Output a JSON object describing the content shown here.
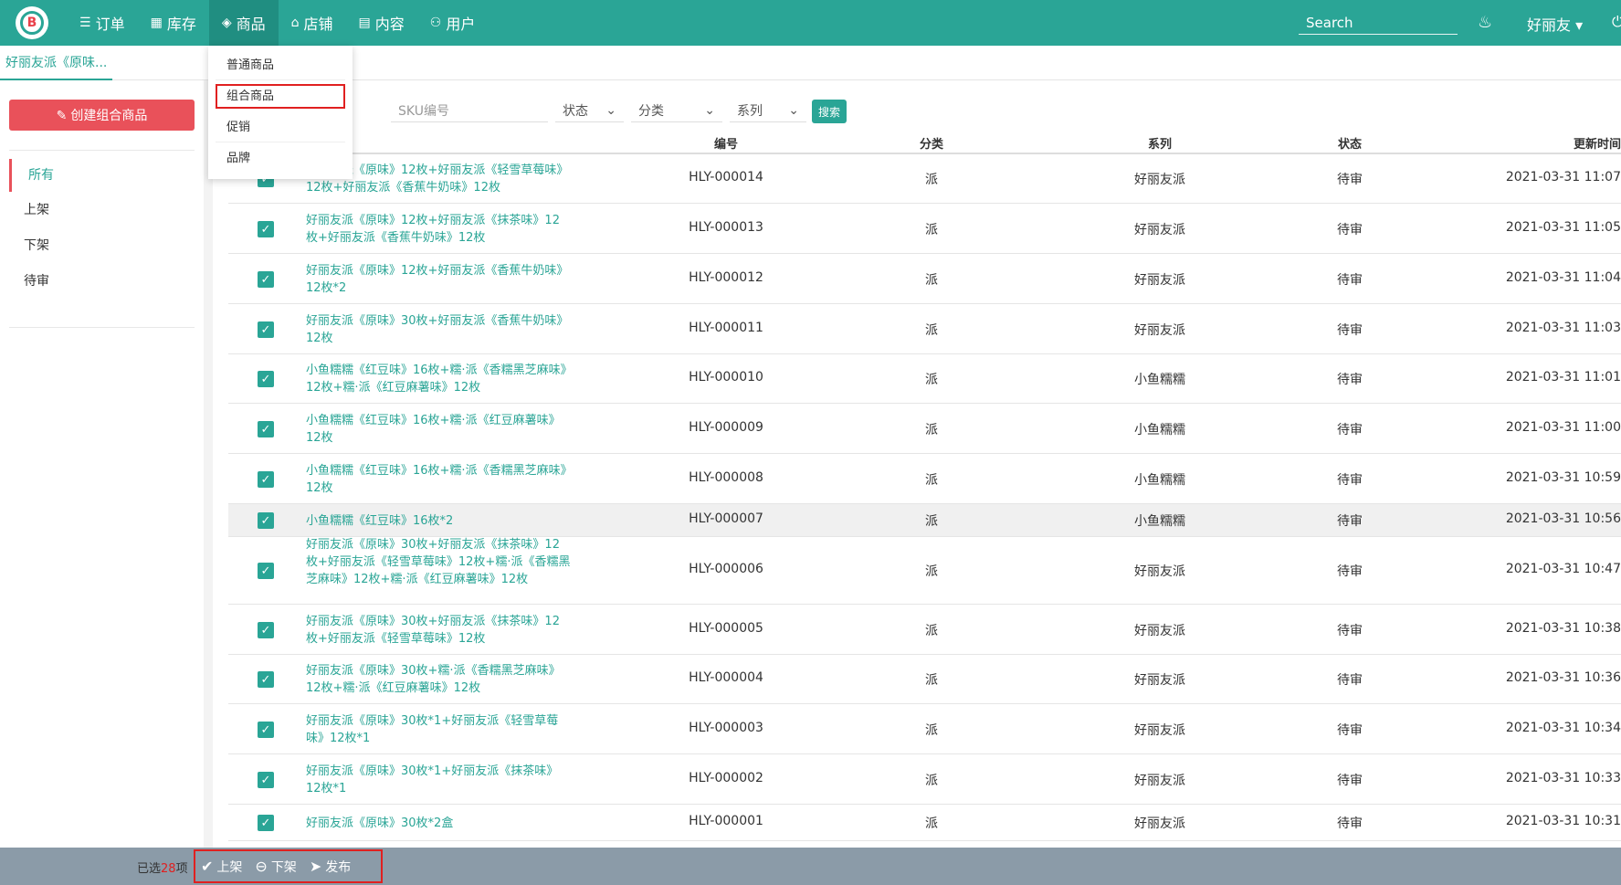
{
  "nav": {
    "items": [
      {
        "label": "订单",
        "icon": "☰"
      },
      {
        "label": "库存",
        "icon": "▦"
      },
      {
        "label": "商品",
        "icon": "◈"
      },
      {
        "label": "店铺",
        "icon": "⌂"
      },
      {
        "label": "内容",
        "icon": "▤"
      },
      {
        "label": "用户",
        "icon": "⚇"
      }
    ],
    "search_placeholder": "Search",
    "user": "好丽友 ▾",
    "bell_icon": "♨",
    "power_icon": "⏻"
  },
  "tab": {
    "label": "好丽友派《原味..."
  },
  "sidebar": {
    "create_button": "创建组合商品",
    "items": [
      "所有",
      "上架",
      "下架",
      "待审"
    ]
  },
  "dropdown": {
    "items": [
      "普通商品",
      "组合商品",
      "促销",
      "品牌"
    ]
  },
  "filters": {
    "sku_placeholder": "SKU编号",
    "status": "状态",
    "category": "分类",
    "series": "系列",
    "search_button": "搜索"
  },
  "table": {
    "headers": {
      "code": "编号",
      "category": "分类",
      "series": "系列",
      "status": "状态",
      "updated": "更新时间"
    },
    "rows": [
      {
        "name": "好丽友派《原味》12枚+好丽友派《轻雪草莓味》12枚+好丽友派《香蕉牛奶味》12枚",
        "code": "HLY-000014",
        "category": "派",
        "series": "好丽友派",
        "status": "待审",
        "updated": "2021-03-31 11:07"
      },
      {
        "name": "好丽友派《原味》12枚+好丽友派《抹茶味》12枚+好丽友派《香蕉牛奶味》12枚",
        "code": "HLY-000013",
        "category": "派",
        "series": "好丽友派",
        "status": "待审",
        "updated": "2021-03-31 11:05"
      },
      {
        "name": "好丽友派《原味》12枚+好丽友派《香蕉牛奶味》12枚*2",
        "code": "HLY-000012",
        "category": "派",
        "series": "好丽友派",
        "status": "待审",
        "updated": "2021-03-31 11:04"
      },
      {
        "name": "好丽友派《原味》30枚+好丽友派《香蕉牛奶味》12枚",
        "code": "HLY-000011",
        "category": "派",
        "series": "好丽友派",
        "status": "待审",
        "updated": "2021-03-31 11:03"
      },
      {
        "name": "小鱼糯糯《红豆味》16枚+糯·派《香糯黑芝麻味》12枚+糯·派《红豆麻薯味》12枚",
        "code": "HLY-000010",
        "category": "派",
        "series": "小鱼糯糯",
        "status": "待审",
        "updated": "2021-03-31 11:01"
      },
      {
        "name": "小鱼糯糯《红豆味》16枚+糯·派《红豆麻薯味》12枚",
        "code": "HLY-000009",
        "category": "派",
        "series": "小鱼糯糯",
        "status": "待审",
        "updated": "2021-03-31 11:00"
      },
      {
        "name": "小鱼糯糯《红豆味》16枚+糯·派《香糯黑芝麻味》12枚",
        "code": "HLY-000008",
        "category": "派",
        "series": "小鱼糯糯",
        "status": "待审",
        "updated": "2021-03-31 10:59"
      },
      {
        "name": "小鱼糯糯《红豆味》16枚*2",
        "code": "HLY-000007",
        "category": "派",
        "series": "小鱼糯糯",
        "status": "待审",
        "updated": "2021-03-31 10:56"
      },
      {
        "name": "好丽友派《原味》30枚+好丽友派《抹茶味》12枚+好丽友派《轻雪草莓味》12枚+糯·派《香糯黑芝麻味》12枚+糯·派《红豆麻薯味》12枚",
        "code": "HLY-000006",
        "category": "派",
        "series": "好丽友派",
        "status": "待审",
        "updated": "2021-03-31 10:47"
      },
      {
        "name": "好丽友派《原味》30枚+好丽友派《抹茶味》12枚+好丽友派《轻雪草莓味》12枚",
        "code": "HLY-000005",
        "category": "派",
        "series": "好丽友派",
        "status": "待审",
        "updated": "2021-03-31 10:38"
      },
      {
        "name": "好丽友派《原味》30枚+糯·派《香糯黑芝麻味》12枚+糯·派《红豆麻薯味》12枚",
        "code": "HLY-000004",
        "category": "派",
        "series": "好丽友派",
        "status": "待审",
        "updated": "2021-03-31 10:36"
      },
      {
        "name": "好丽友派《原味》30枚*1+好丽友派《轻雪草莓味》12枚*1",
        "code": "HLY-000003",
        "category": "派",
        "series": "好丽友派",
        "status": "待审",
        "updated": "2021-03-31 10:34"
      },
      {
        "name": "好丽友派《原味》30枚*1+好丽友派《抹茶味》12枚*1",
        "code": "HLY-000002",
        "category": "派",
        "series": "好丽友派",
        "status": "待审",
        "updated": "2021-03-31 10:33"
      },
      {
        "name": "好丽友派《原味》30枚*2盒",
        "code": "HLY-000001",
        "category": "派",
        "series": "好丽友派",
        "status": "待审",
        "updated": "2021-03-31 10:31"
      }
    ]
  },
  "bottom": {
    "selected_prefix": "已选",
    "selected_count": "28",
    "selected_suffix": "项",
    "actions": [
      {
        "label": "上架",
        "icon": "✔"
      },
      {
        "label": "下架",
        "icon": "⊖"
      },
      {
        "label": "发布",
        "icon": "➤"
      }
    ]
  },
  "colors": {
    "brand": "#2aa596",
    "danger": "#e9515a",
    "highlight_box": "#e02020"
  }
}
